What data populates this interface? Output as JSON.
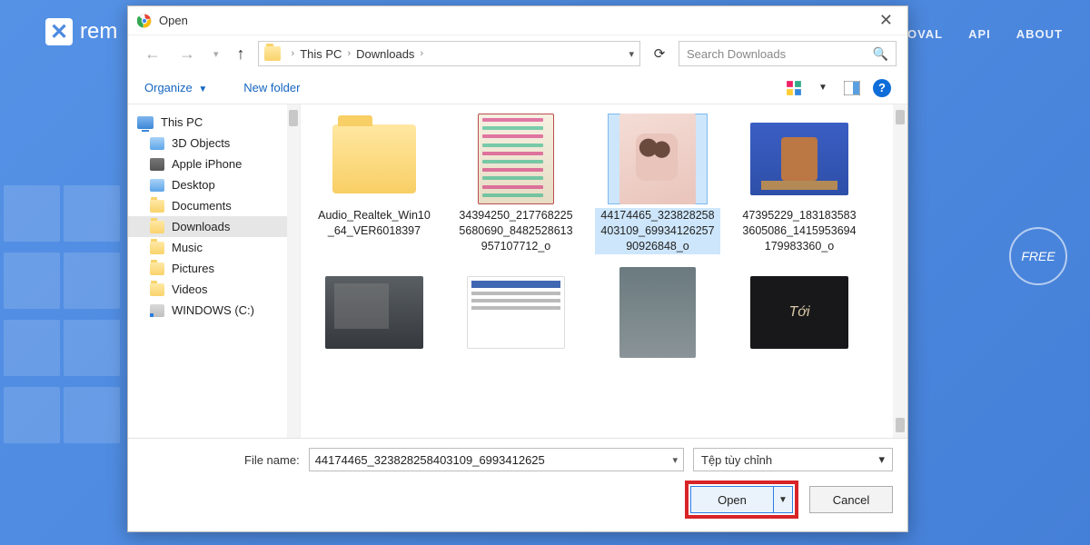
{
  "background": {
    "logo_text": "rem",
    "nav": {
      "item1": "MOVAL",
      "item2": "API",
      "item3": "ABOUT"
    },
    "free_badge": "FREE"
  },
  "dialog": {
    "title": "Open",
    "close": "✕",
    "breadcrumb": {
      "root": "This PC",
      "folder": "Downloads"
    },
    "search_placeholder": "Search Downloads",
    "toolbar": {
      "organize": "Organize",
      "new_folder": "New folder"
    },
    "tree": {
      "root": "This PC",
      "items": [
        "3D Objects",
        "Apple iPhone",
        "Desktop",
        "Documents",
        "Downloads",
        "Music",
        "Pictures",
        "Videos",
        "WINDOWS (C:)"
      ],
      "selected_index": 4
    },
    "files": [
      {
        "name": "Audio_Realtek_Win10_64_VER6018397",
        "type": "folder"
      },
      {
        "name": "34394250_2177682255680690_8482528613957107712_o",
        "type": "image"
      },
      {
        "name": "44174465_3238282584031­09_6993412625790926848_o",
        "type": "image",
        "selected": true
      },
      {
        "name": "47395229_1831835833605086_1415953694179983360_o",
        "type": "image"
      },
      {
        "name": "",
        "type": "image"
      },
      {
        "name": "",
        "type": "image"
      },
      {
        "name": "",
        "type": "image"
      },
      {
        "name": "",
        "type": "image"
      }
    ],
    "footer": {
      "filename_label": "File name:",
      "filename_value": "44174465_323828258403109_6993412625",
      "filter": "Tệp tùy chỉnh",
      "open": "Open",
      "cancel": "Cancel"
    }
  }
}
